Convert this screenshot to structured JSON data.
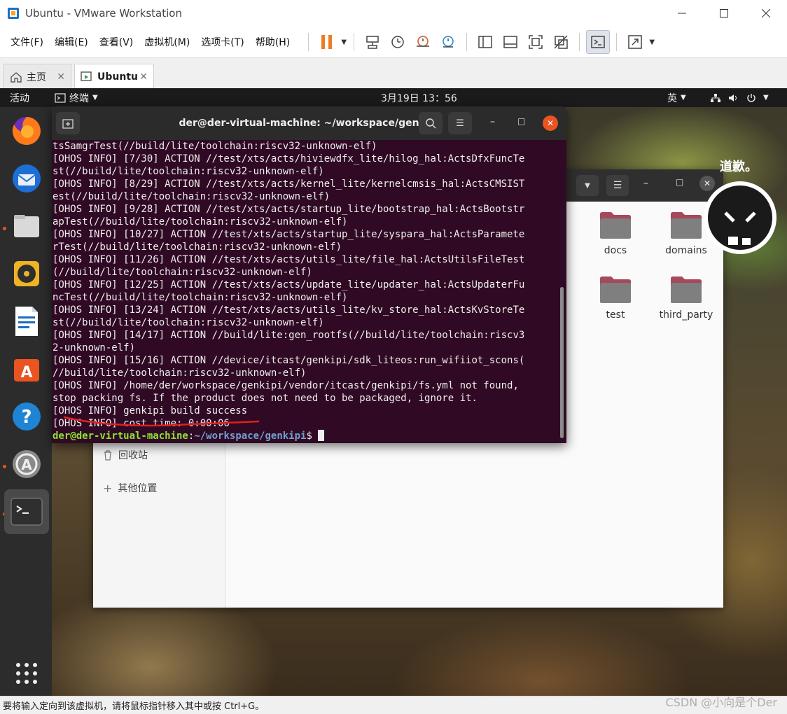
{
  "window": {
    "title": "Ubuntu - VMware Workstation",
    "controls": [
      "minimize",
      "maximize",
      "close"
    ]
  },
  "menubar": {
    "items": [
      "文件(F)",
      "编辑(E)",
      "查看(V)",
      "虚拟机(M)",
      "选项卡(T)",
      "帮助(H)"
    ]
  },
  "tabs": [
    {
      "label": "主页",
      "icon": "home-icon"
    },
    {
      "label": "Ubuntu",
      "icon": "vm-icon",
      "active": true
    }
  ],
  "ubuntu_topbar": {
    "activities": "活动",
    "app_menu": "终端",
    "clock": "3月19日  13：56",
    "input_method": "英"
  },
  "terminal": {
    "title": "der@der-virtual-machine: ~/workspace/genkipi",
    "lines": [
      "tsSamgrTest(//build/lite/toolchain:riscv32-unknown-elf)",
      "[OHOS INFO] [7/30] ACTION //test/xts/acts/hiviewdfx_lite/hilog_hal:ActsDfxFuncTe",
      "st(//build/lite/toolchain:riscv32-unknown-elf)",
      "[OHOS INFO] [8/29] ACTION //test/xts/acts/kernel_lite/kernelcmsis_hal:ActsCMSIST",
      "est(//build/lite/toolchain:riscv32-unknown-elf)",
      "[OHOS INFO] [9/28] ACTION //test/xts/acts/startup_lite/bootstrap_hal:ActsBootstr",
      "apTest(//build/lite/toolchain:riscv32-unknown-elf)",
      "[OHOS INFO] [10/27] ACTION //test/xts/acts/startup_lite/syspara_hal:ActsParamete",
      "rTest(//build/lite/toolchain:riscv32-unknown-elf)",
      "[OHOS INFO] [11/26] ACTION //test/xts/acts/utils_lite/file_hal:ActsUtilsFileTest",
      "(//build/lite/toolchain:riscv32-unknown-elf)",
      "[OHOS INFO] [12/25] ACTION //test/xts/acts/update_lite/updater_hal:ActsUpdaterFu",
      "ncTest(//build/lite/toolchain:riscv32-unknown-elf)",
      "[OHOS INFO] [13/24] ACTION //test/xts/acts/utils_lite/kv_store_hal:ActsKvStoreTe",
      "st(//build/lite/toolchain:riscv32-unknown-elf)",
      "[OHOS INFO] [14/17] ACTION //build/lite:gen_rootfs(//build/lite/toolchain:riscv3",
      "2-unknown-elf)",
      "[OHOS INFO] [15/16] ACTION //device/itcast/genkipi/sdk_liteos:run_wifiiot_scons(",
      "//build/lite/toolchain:riscv32-unknown-elf)",
      "[OHOS INFO] /home/der/workspace/genkipi/vendor/itcast/genkipi/fs.yml not found,",
      "stop packing fs. If the product does not need to be packaged, ignore it.",
      "[OHOS INFO] genkipi build success",
      "[OHOS INFO] cost time: 0:00:06"
    ],
    "prompt_user": "der@der-virtual-machine",
    "prompt_sep": ":",
    "prompt_path": "~/workspace/genkipi",
    "prompt_end": "$ "
  },
  "file_manager": {
    "sidebar": [
      "回收站",
      "其他位置"
    ],
    "folders": [
      "docs",
      "domains",
      "test",
      "third_party"
    ]
  },
  "avatar_caption": "道歉。",
  "statusbar": {
    "hint": "要将输入定向到该虚拟机，请将鼠标指针移入其中或按 Ctrl+G。"
  },
  "watermark": "CSDN @小向是个Der",
  "colors": {
    "terminal_bg": "#300a24",
    "prompt_user": "#8ae234",
    "prompt_path": "#729fcf",
    "pause_orange": "#f07c22",
    "close_red": "#e95420",
    "annotation_red": "#e0201b"
  }
}
